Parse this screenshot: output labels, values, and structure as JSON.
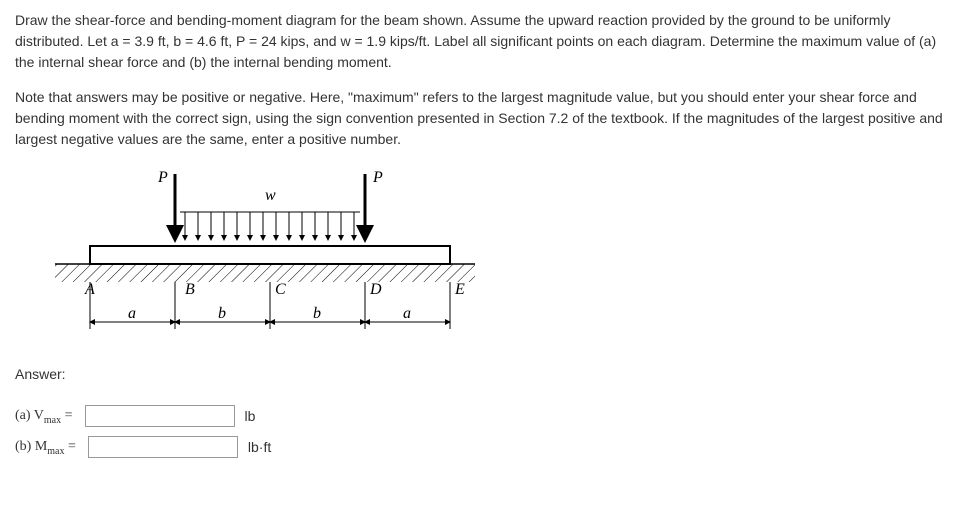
{
  "problem": {
    "p1": "Draw the shear-force and bending-moment diagram for the beam shown.  Assume the upward reaction provided by the ground to be uniformly distributed.  Let a = 3.9 ft, b = 4.6 ft, P = 24 kips, and w = 1.9 kips/ft.  Label all significant points on each diagram.  Determine the maximum value of (a) the internal shear force and (b) the internal bending moment.",
    "p2": "Note that answers may be positive or negative. Here, \"maximum\" refers to the largest magnitude value, but you should enter your shear force and bending moment with the correct sign, using the sign convention presented in Section 7.2 of the textbook. If the magnitudes of the largest positive and largest negative values are the same, enter a positive number."
  },
  "diagram": {
    "P_left": "P",
    "P_right": "P",
    "w": "w",
    "A": "A",
    "B": "B",
    "C": "C",
    "D": "D",
    "E": "E",
    "a1": "a",
    "b1": "b",
    "b2": "b",
    "a2": "a"
  },
  "answer": {
    "heading": "Answer:",
    "vmax_label_a": "(a) V",
    "vmax_label_sub": "max",
    "vmax_label_eq": " = ",
    "vmax_unit": "lb",
    "mmax_label_a": "(b) M",
    "mmax_label_sub": "max",
    "mmax_label_eq": " = ",
    "mmax_unit": "lb·ft"
  }
}
